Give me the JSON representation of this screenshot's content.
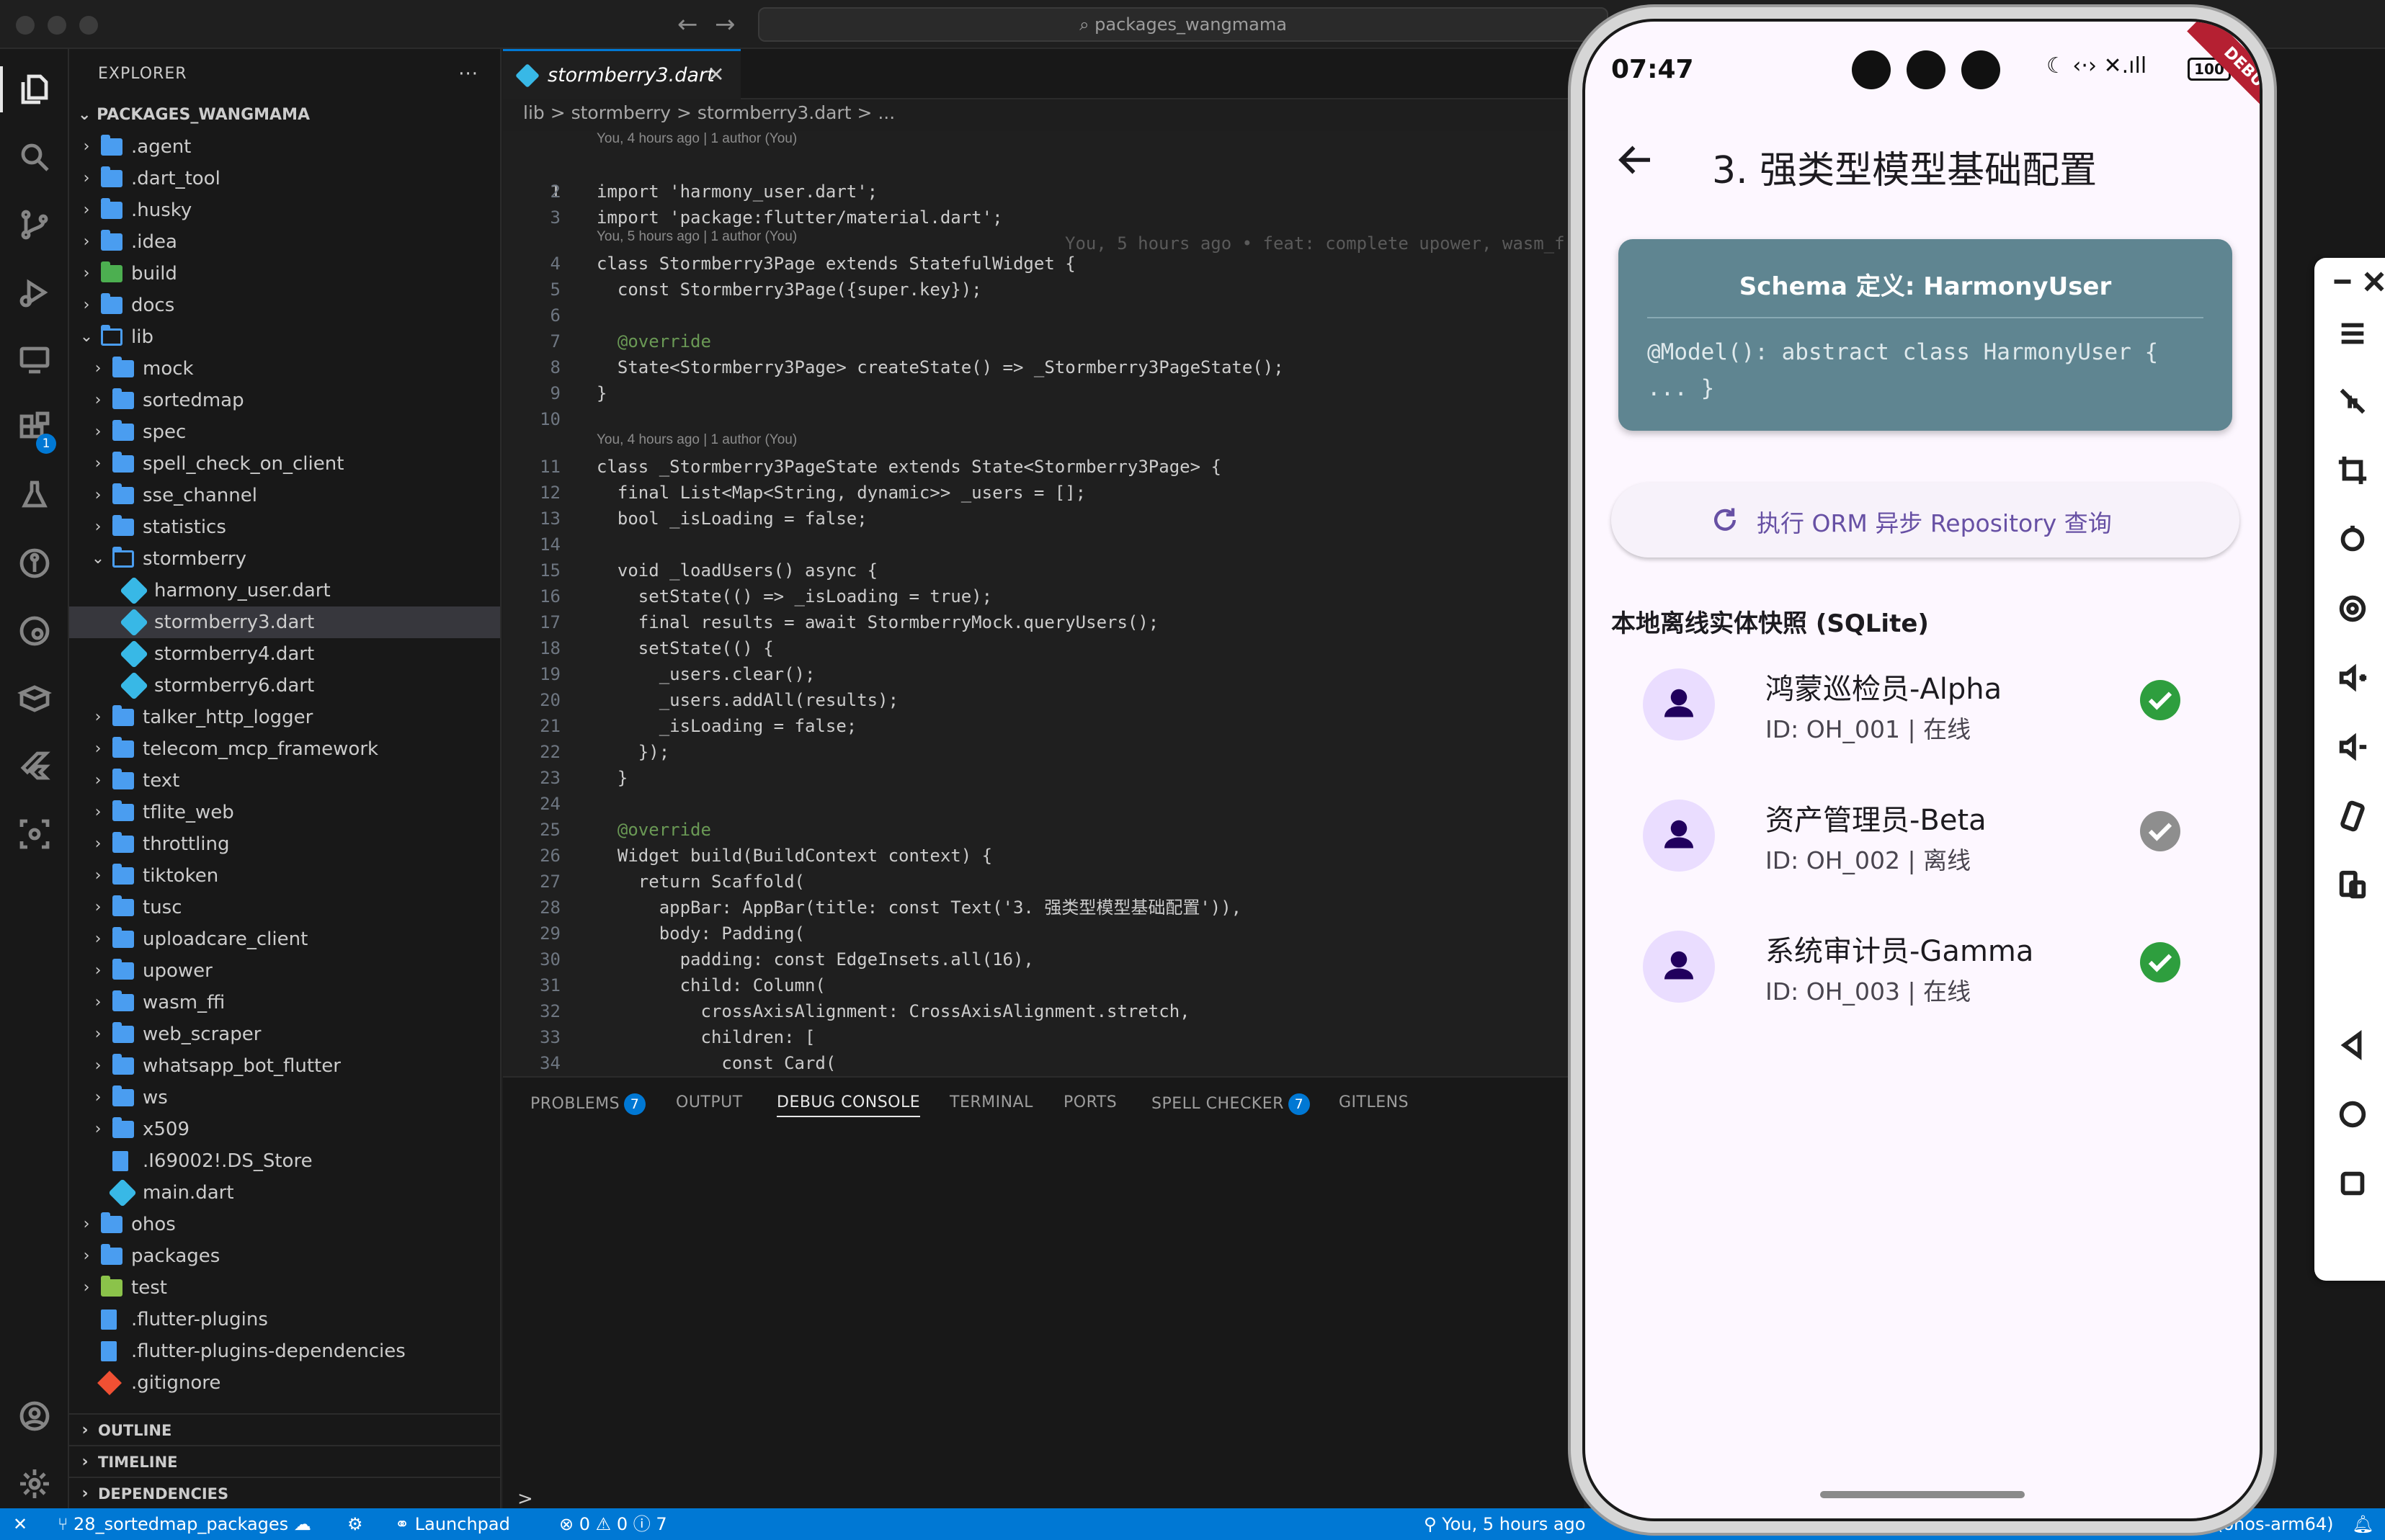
{
  "window": {
    "search": "packages_wangmama"
  },
  "explorer": {
    "title": "EXPLORER",
    "more": "···",
    "root": "PACKAGES_WANGMAMA",
    "items": [
      {
        "name": ".agent",
        "depth": 0,
        "kind": "folder",
        "state": "closed"
      },
      {
        "name": ".dart_tool",
        "depth": 0,
        "kind": "folder",
        "state": "closed"
      },
      {
        "name": ".husky",
        "depth": 0,
        "kind": "folder",
        "state": "closed"
      },
      {
        "name": ".idea",
        "depth": 0,
        "kind": "folder",
        "state": "closed"
      },
      {
        "name": "build",
        "depth": 0,
        "kind": "special",
        "state": "closed"
      },
      {
        "name": "docs",
        "depth": 0,
        "kind": "folder",
        "state": "closed"
      },
      {
        "name": "lib",
        "depth": 0,
        "kind": "folder",
        "state": "open"
      },
      {
        "name": "mock",
        "depth": 1,
        "kind": "folder",
        "state": "closed"
      },
      {
        "name": "sortedmap",
        "depth": 1,
        "kind": "folder",
        "state": "closed"
      },
      {
        "name": "spec",
        "depth": 1,
        "kind": "folder",
        "state": "closed"
      },
      {
        "name": "spell_check_on_client",
        "depth": 1,
        "kind": "folder",
        "state": "closed"
      },
      {
        "name": "sse_channel",
        "depth": 1,
        "kind": "folder",
        "state": "closed"
      },
      {
        "name": "statistics",
        "depth": 1,
        "kind": "folder",
        "state": "closed"
      },
      {
        "name": "stormberry",
        "depth": 1,
        "kind": "folder",
        "state": "open"
      },
      {
        "name": "harmony_user.dart",
        "depth": 2,
        "kind": "dart",
        "state": "file"
      },
      {
        "name": "stormberry3.dart",
        "depth": 2,
        "kind": "dart",
        "state": "file",
        "selected": true
      },
      {
        "name": "stormberry4.dart",
        "depth": 2,
        "kind": "dart",
        "state": "file"
      },
      {
        "name": "stormberry6.dart",
        "depth": 2,
        "kind": "dart",
        "state": "file"
      },
      {
        "name": "talker_http_logger",
        "depth": 1,
        "kind": "folder",
        "state": "closed"
      },
      {
        "name": "telecom_mcp_framework",
        "depth": 1,
        "kind": "folder",
        "state": "closed"
      },
      {
        "name": "text",
        "depth": 1,
        "kind": "folder",
        "state": "closed"
      },
      {
        "name": "tflite_web",
        "depth": 1,
        "kind": "folder",
        "state": "closed"
      },
      {
        "name": "throttling",
        "depth": 1,
        "kind": "folder",
        "state": "closed"
      },
      {
        "name": "tiktoken",
        "depth": 1,
        "kind": "folder",
        "state": "closed"
      },
      {
        "name": "tusc",
        "depth": 1,
        "kind": "folder",
        "state": "closed"
      },
      {
        "name": "uploadcare_client",
        "depth": 1,
        "kind": "folder",
        "state": "closed"
      },
      {
        "name": "upower",
        "depth": 1,
        "kind": "folder",
        "state": "closed"
      },
      {
        "name": "wasm_ffi",
        "depth": 1,
        "kind": "folder",
        "state": "closed"
      },
      {
        "name": "web_scraper",
        "depth": 1,
        "kind": "folder",
        "state": "closed"
      },
      {
        "name": "whatsapp_bot_flutter",
        "depth": 1,
        "kind": "folder",
        "state": "closed"
      },
      {
        "name": "ws",
        "depth": 1,
        "kind": "folder",
        "state": "closed"
      },
      {
        "name": "x509",
        "depth": 1,
        "kind": "folder",
        "state": "closed"
      },
      {
        "name": ".I69002!.DS_Store",
        "depth": 1,
        "kind": "file",
        "state": "file"
      },
      {
        "name": "main.dart",
        "depth": 1,
        "kind": "dart",
        "state": "file"
      },
      {
        "name": "ohos",
        "depth": 0,
        "kind": "folder",
        "state": "closed"
      },
      {
        "name": "packages",
        "depth": 0,
        "kind": "folder",
        "state": "closed"
      },
      {
        "name": "test",
        "depth": 0,
        "kind": "test",
        "state": "closed"
      },
      {
        "name": ".flutter-plugins",
        "depth": 0,
        "kind": "file",
        "state": "file"
      },
      {
        "name": ".flutter-plugins-dependencies",
        "depth": 0,
        "kind": "file",
        "state": "file"
      },
      {
        "name": ".gitignore",
        "depth": 0,
        "kind": "git",
        "state": "file"
      }
    ],
    "sections": [
      "OUTLINE",
      "TIMELINE",
      "DEPENDENCIES"
    ]
  },
  "editor": {
    "tab": "stormberry3.dart",
    "breadcrumb": "lib  >  stormberry  >  stormberry3.dart  >  ...",
    "blame_top": "You, 4 hours ago | 1 author (You)",
    "blame_class1": "You, 5 hours ago | 1 author (You)",
    "blame_class2": "You, 4 hours ago | 1 author (You)",
    "ghost_line1": "You, 5 hours ago • feat: complete upower, wasm_f",
    "lines": {
      "l1": "import 'package:flutter/material.dart';",
      "l2": "import 'harmony_user.dart';",
      "l4": "class Stormberry3Page extends StatefulWidget {",
      "l5": "  const Stormberry3Page({super.key});",
      "l7": "  @override",
      "l8": "  State<Stormberry3Page> createState() => _Stormberry3PageState();",
      "l9": "}",
      "l11": "class _Stormberry3PageState extends State<Stormberry3Page> {",
      "l12": "  final List<Map<String, dynamic>> _users = [];",
      "l13": "  bool _isLoading = false;",
      "l15": "  void _loadUsers() async {",
      "l16": "    setState(() => _isLoading = true);",
      "l17": "    final results = await StormberryMock.queryUsers();",
      "l18": "    setState(() {",
      "l19": "      _users.clear();",
      "l20": "      _users.addAll(results);",
      "l21": "      _isLoading = false;",
      "l22": "    });",
      "l23": "  }",
      "l25": "  @override",
      "l26": "  Widget build(BuildContext context) {",
      "l27": "    return Scaffold(",
      "l28": "      appBar: AppBar(title: const Text('3. 强类型模型基础配置')),",
      "l29": "      body: Padding(",
      "l30": "        padding: const EdgeInsets.all(16),",
      "l31": "        child: Column(",
      "l32": "          crossAxisAlignment: CrossAxisAlignment.stretch,",
      "l33": "          children: [",
      "l34": "            const Card("
    }
  },
  "panel": {
    "tabs": [
      "PROBLEMS",
      "OUTPUT",
      "DEBUG CONSOLE",
      "TERMINAL",
      "PORTS",
      "SPELL CHECKER",
      "GITLENS"
    ],
    "problems_count": "7",
    "spell_count": "7",
    "prompt": ">"
  },
  "statusbar": {
    "remote": "✕",
    "branch": "28_sortedmap_packages",
    "launchpad": "Launchpad",
    "errors": "0",
    "warnings": "0",
    "info": "7",
    "blame": "You, 5 hours ago",
    "device": "(ohos-arm64)"
  },
  "phone": {
    "time": "07:47",
    "status_icons": "☾ ‹·› ✕.ıll",
    "battery": "100",
    "debug_banner": "DEBUG",
    "appbar_title": "3. 强类型模型基础配置",
    "card": {
      "title": "Schema 定义: HarmonyUser",
      "code": "@Model(): abstract class HarmonyUser { ... }"
    },
    "query_button": "执行 ORM 异步 Repository 查询",
    "section_title": "本地离线实体快照 (SQLite)",
    "users": [
      {
        "name": "鸿蒙巡检员-Alpha",
        "detail": "ID: OH_001 | 在线",
        "online": true
      },
      {
        "name": "资产管理员-Beta",
        "detail": "ID: OH_002 | 离线",
        "online": false
      },
      {
        "name": "系统审计员-Gamma",
        "detail": "ID: OH_003 | 在线",
        "online": true
      }
    ]
  },
  "colors": {
    "accent": "#0078d4",
    "card": "#5f8591",
    "primary": "#6750a4",
    "online": "#2e9e3e",
    "offline": "#8e8e8e",
    "debug": "#b52032"
  }
}
